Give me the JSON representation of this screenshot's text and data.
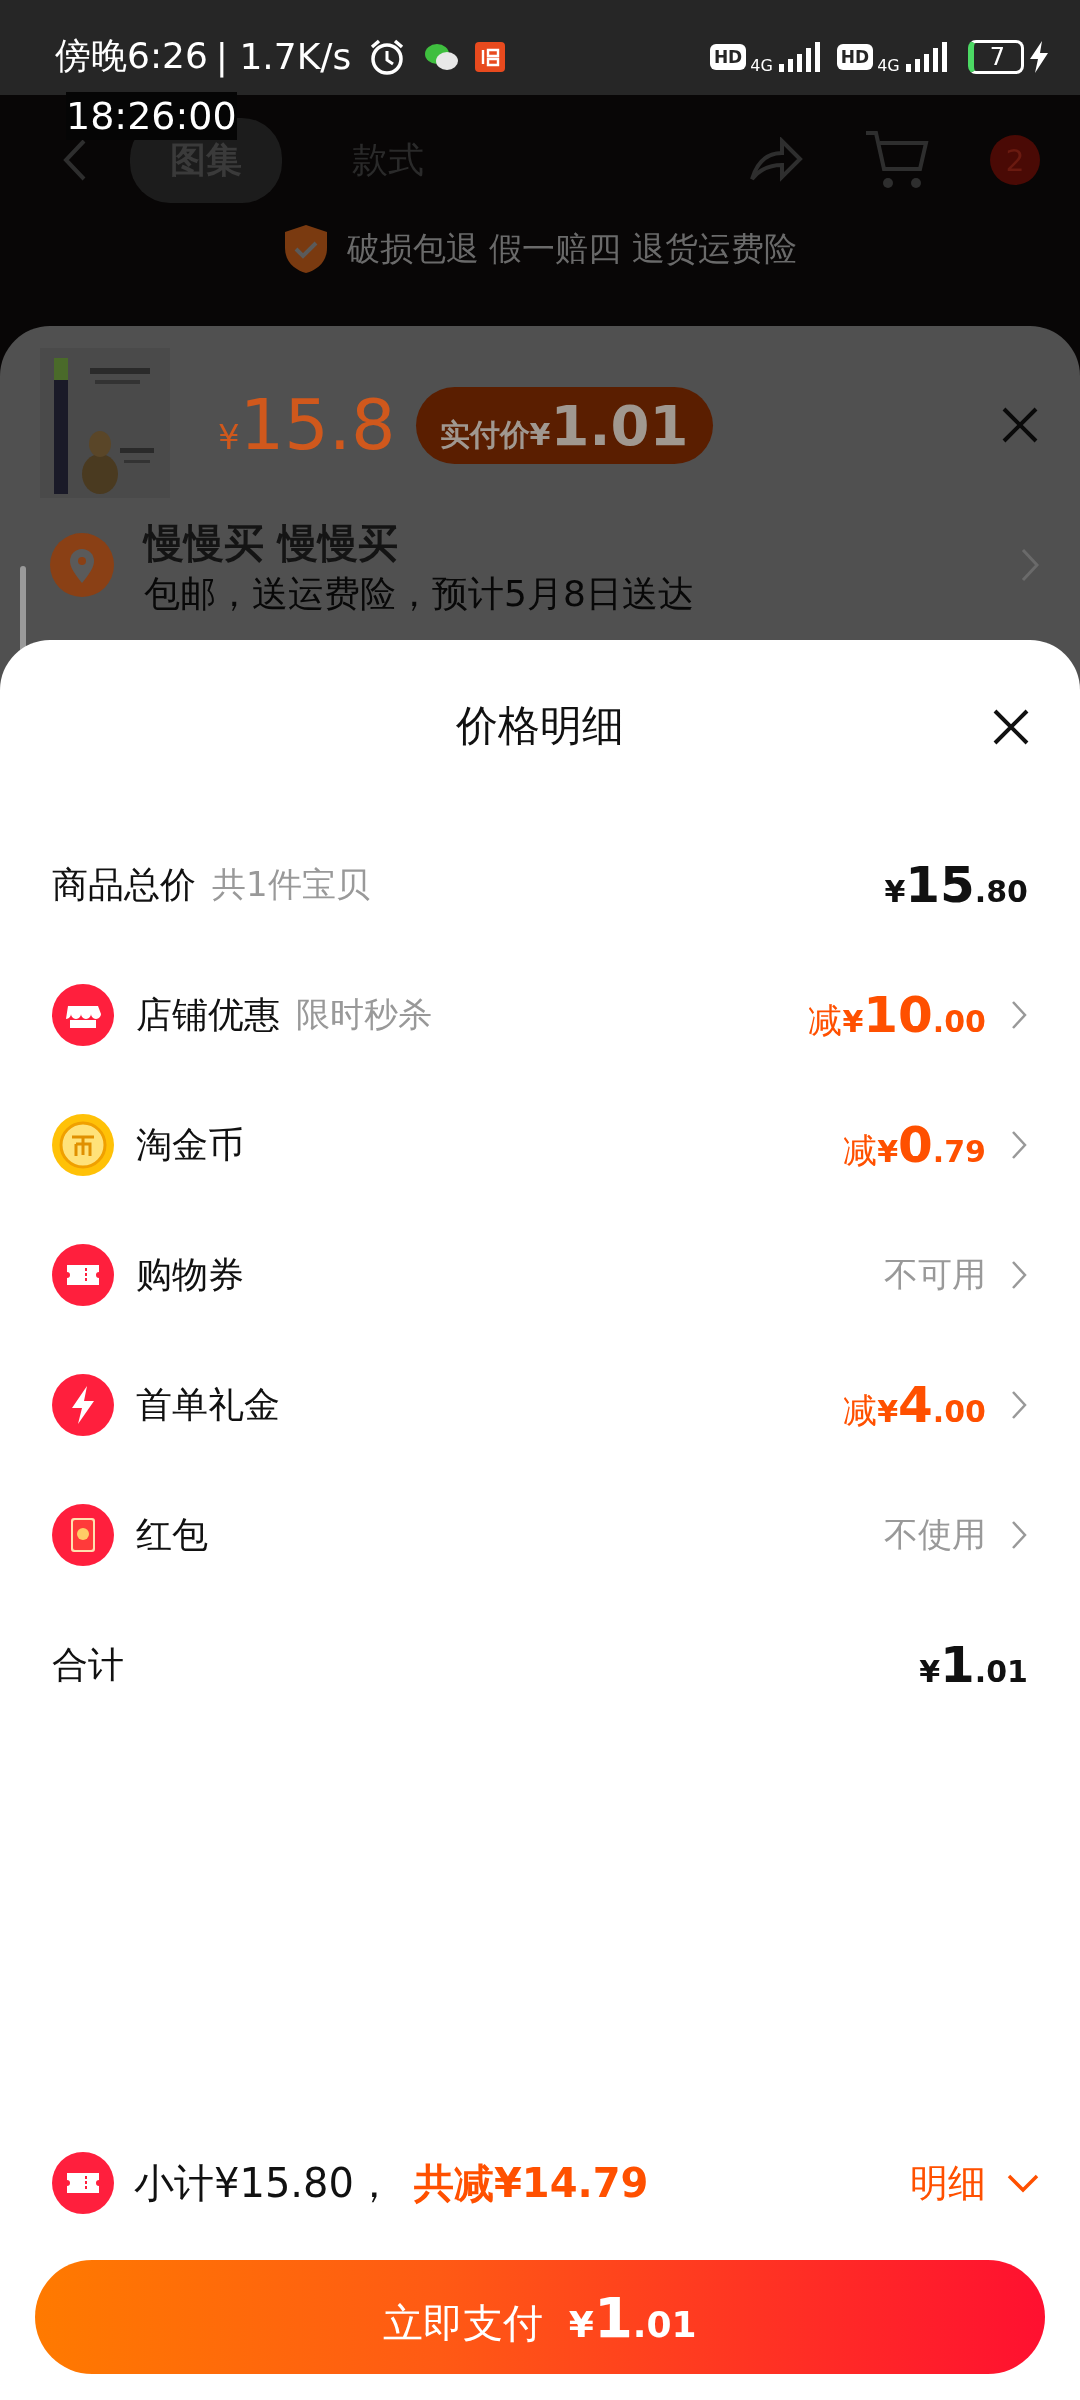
{
  "status_bar": {
    "time": "傍晚6:26",
    "speed": "| 1.7K/s",
    "sim": [
      {
        "hd": "HD",
        "net": "4G"
      },
      {
        "hd": "HD",
        "net": "4G"
      }
    ],
    "battery": "7"
  },
  "time_overlay": "18:26:00",
  "header": {
    "tabs": [
      {
        "label": "图集",
        "selected": true
      },
      {
        "label": "款式",
        "selected": false
      }
    ],
    "cart_badge": "2"
  },
  "guarantee": "破损包退 假一赔四 退货运费险",
  "product_sheet": {
    "price_currency": "¥",
    "price": "15.8",
    "pay_label": "实付价",
    "pay_currency": "¥",
    "pay_price": "1.01",
    "address_name": "慢慢买 慢慢买",
    "address_detail": "包邮，送运费险，预计5月8日送达"
  },
  "detail_sheet": {
    "title": "价格明细",
    "rows": [
      {
        "kind": "total",
        "label": "商品总价",
        "sub": "共1件宝贝",
        "value": {
          "kind": "price",
          "currency": "¥",
          "integer": "15",
          "decimal": ".80"
        },
        "chevron": false
      },
      {
        "kind": "store",
        "label": "店铺优惠",
        "sub": "限时秒杀",
        "value": {
          "kind": "discount",
          "prefix": "减",
          "currency": "¥",
          "integer": "10",
          "decimal": ".00"
        },
        "chevron": true
      },
      {
        "kind": "coin",
        "label": "淘金币",
        "value": {
          "kind": "discount",
          "prefix": "减",
          "currency": "¥",
          "integer": "0",
          "decimal": ".79"
        },
        "chevron": true
      },
      {
        "kind": "ticket",
        "label": "购物券",
        "value": {
          "kind": "status",
          "text": "不可用"
        },
        "chevron": true
      },
      {
        "kind": "bolt",
        "label": "首单礼金",
        "value": {
          "kind": "discount",
          "prefix": "减",
          "currency": "¥",
          "integer": "4",
          "decimal": ".00"
        },
        "chevron": true
      },
      {
        "kind": "envelope",
        "label": "红包",
        "value": {
          "kind": "status",
          "text": "不使用"
        },
        "chevron": true
      },
      {
        "kind": "total",
        "label": "合计",
        "value": {
          "kind": "price",
          "currency": "¥",
          "integer": "1",
          "decimal": ".01"
        },
        "chevron": false
      }
    ],
    "subtotal": "小计¥15.80，",
    "total_discount": "共减¥14.79",
    "detail_toggle": "明细",
    "pay_button": {
      "label": "立即支付",
      "currency": "¥",
      "integer": "1",
      "decimal": ".01"
    }
  }
}
